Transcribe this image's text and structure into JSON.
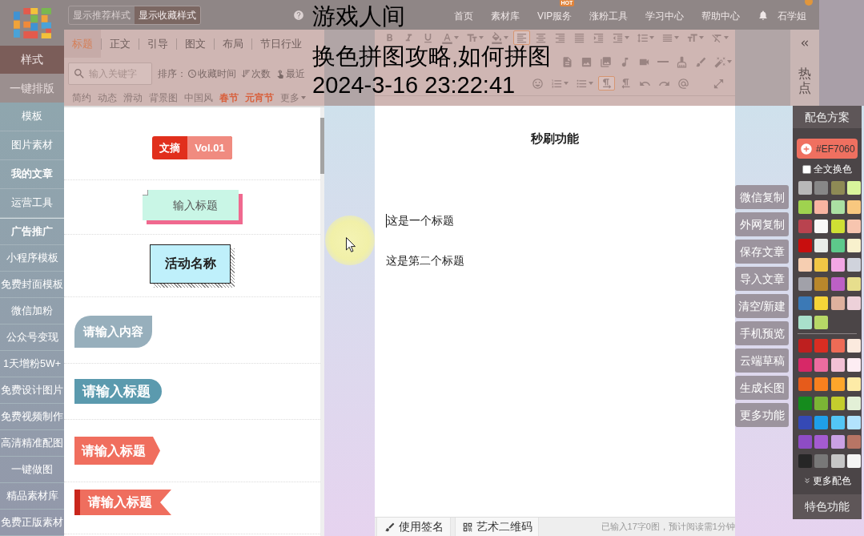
{
  "overlay_caption": {
    "lines": [
      "游戏人间",
      "换色拼图攻略,如何拼图",
      "2024-3-16 23:22:41"
    ]
  },
  "top_bar": {
    "style_toggle": [
      {
        "label": "显示推荐样式",
        "selected": false
      },
      {
        "label": "显示收藏样式",
        "selected": true
      }
    ],
    "nav": [
      {
        "label": "首页"
      },
      {
        "label": "素材库"
      },
      {
        "label": "VIP服务",
        "badge": "HOT"
      },
      {
        "label": "涨粉工具"
      },
      {
        "label": "学习中心"
      },
      {
        "label": "帮助中心"
      }
    ],
    "user": {
      "name": "石学姐",
      "badge_dot": true
    }
  },
  "mode_tabs": [
    {
      "label": "样式",
      "selected": true
    },
    {
      "label": "一键排版",
      "selected": false
    }
  ],
  "sidebar": {
    "groups": [
      [
        {
          "label": "模板",
          "bold": false
        },
        {
          "label": "图片素材",
          "bold": false
        },
        {
          "label": "我的文章",
          "bold": true
        },
        {
          "label": "运营工具",
          "bold": false
        }
      ],
      [
        {
          "label": "广告推广",
          "bold": true
        },
        {
          "label": "小程序模板",
          "bold": false
        },
        {
          "label": "免费封面模板",
          "bold": false
        },
        {
          "label": "微信加粉",
          "bold": false
        },
        {
          "label": "公众号变现",
          "bold": false
        },
        {
          "label": "1天增粉5W+",
          "bold": false
        },
        {
          "label": "免费设计图片",
          "bold": false
        },
        {
          "label": "免费视频制作",
          "bold": false
        },
        {
          "label": "高清精准配图",
          "bold": false
        },
        {
          "label": "一键做图",
          "bold": false
        },
        {
          "label": "精品素材库",
          "bold": false
        },
        {
          "label": "免费正版素材",
          "bold": false
        }
      ]
    ]
  },
  "style_panel": {
    "tabs": [
      {
        "label": "标题",
        "selected": true
      },
      {
        "label": "正文",
        "selected": false
      },
      {
        "label": "引导",
        "selected": false
      },
      {
        "label": "图文",
        "selected": false
      },
      {
        "label": "布局",
        "selected": false
      },
      {
        "label": "节日行业",
        "selected": false
      }
    ],
    "search": {
      "placeholder": "输入关键字"
    },
    "sort": {
      "label": "排序：",
      "options": [
        {
          "kind": "time",
          "label": "收藏时间"
        },
        {
          "kind": "count",
          "label": "次数"
        },
        {
          "kind": "recent",
          "label": "最近"
        }
      ]
    },
    "categories": [
      {
        "label": "简约",
        "featured": false
      },
      {
        "label": "动态",
        "featured": false
      },
      {
        "label": "滑动",
        "featured": false
      },
      {
        "label": "背景图",
        "featured": false
      },
      {
        "label": "中国风",
        "featured": false
      },
      {
        "label": "春节",
        "featured": true
      },
      {
        "label": "元宵节",
        "featured": true
      },
      {
        "label": "更多",
        "featured": false
      }
    ],
    "templates": [
      {
        "kind": "badge",
        "tag": "文摘",
        "issue": "Vol.01"
      },
      {
        "kind": "shadow",
        "text": "输入标题"
      },
      {
        "kind": "box3d",
        "text": "活动名称"
      },
      {
        "kind": "tab",
        "text": "请输入内容"
      },
      {
        "kind": "pill",
        "text": "请输入标题"
      },
      {
        "kind": "arrow",
        "text": "请输入标题"
      },
      {
        "kind": "ribbon",
        "text": "请输入标题"
      }
    ]
  },
  "toolbar": {
    "rows": [
      [
        {
          "kind": "bold",
          "selected": false,
          "dropdown": false
        },
        {
          "kind": "italic",
          "selected": false,
          "dropdown": false
        },
        {
          "kind": "underline",
          "selected": false,
          "dropdown": false
        },
        {
          "kind": "font-color",
          "selected": false,
          "dropdown": true
        },
        {
          "kind": "font-size",
          "selected": false,
          "dropdown": true
        },
        {
          "kind": "highlight",
          "selected": false,
          "dropdown": true
        },
        {
          "kind": "align-left",
          "selected": true,
          "dropdown": false
        },
        {
          "kind": "align-center",
          "selected": false,
          "dropdown": false
        },
        {
          "kind": "align-right",
          "selected": false,
          "dropdown": false
        },
        {
          "kind": "justify",
          "selected": false,
          "dropdown": false
        },
        {
          "kind": "indent",
          "selected": false,
          "dropdown": false
        },
        {
          "kind": "outdent",
          "selected": false,
          "dropdown": true
        },
        {
          "kind": "line-height",
          "selected": false,
          "dropdown": true
        },
        {
          "kind": "paragraph-spacing",
          "selected": false,
          "dropdown": true
        },
        {
          "kind": "letter-spacing",
          "selected": false,
          "dropdown": true
        },
        {
          "kind": "clear-format",
          "selected": false,
          "dropdown": true
        }
      ],
      [
        {
          "kind": "document",
          "selected": false,
          "dropdown": false
        },
        {
          "kind": "image",
          "selected": false,
          "dropdown": false
        },
        {
          "kind": "gallery",
          "selected": false,
          "dropdown": false
        },
        {
          "kind": "music",
          "selected": false,
          "dropdown": false
        },
        {
          "kind": "video",
          "selected": false,
          "dropdown": false
        },
        {
          "kind": "horizontal-rule",
          "selected": false,
          "dropdown": false
        },
        {
          "kind": "eraser",
          "selected": false,
          "dropdown": false
        },
        {
          "kind": "format-painter",
          "selected": false,
          "dropdown": false
        },
        {
          "kind": "magic-wand",
          "selected": false,
          "dropdown": true
        }
      ],
      [
        {
          "kind": "emoji",
          "selected": false,
          "dropdown": false
        },
        {
          "kind": "ordered-list",
          "selected": false,
          "dropdown": true
        },
        {
          "kind": "bullet-list",
          "selected": false,
          "dropdown": true
        },
        {
          "kind": "ltr",
          "selected": true,
          "dropdown": false
        },
        {
          "kind": "rtl",
          "selected": false,
          "dropdown": false
        },
        {
          "kind": "undo",
          "selected": false,
          "dropdown": false
        },
        {
          "kind": "redo",
          "selected": false,
          "dropdown": false
        },
        {
          "kind": "mention",
          "selected": false,
          "dropdown": false
        }
      ]
    ],
    "right": [
      {
        "kind": "fullscreen",
        "selected": false,
        "dropdown": false
      }
    ]
  },
  "side_strip": {
    "label": "热点"
  },
  "editor": {
    "title": "秒刷功能",
    "paragraphs": [
      {
        "text": "这是一个标题",
        "caret": true
      },
      {
        "text": "这是第二个标题",
        "caret": false
      }
    ],
    "footer": {
      "buttons": [
        {
          "kind": "signature",
          "label": "使用签名"
        },
        {
          "kind": "qrcode",
          "label": "艺术二维码"
        }
      ],
      "status": "已输入17字0图，预计阅读需1分钟"
    }
  },
  "actions": [
    "微信复制",
    "外网复制",
    "保存文章",
    "导入文章",
    "清空/新建",
    "手机预览",
    "云端草稿",
    "生成长图",
    "更多功能"
  ],
  "color_panel": {
    "title": "配色方案",
    "current": {
      "value": "#EF7060",
      "color": "#ef7060"
    },
    "apply_all": {
      "label": "全文换色",
      "checked": false
    },
    "swatch_groups": [
      [
        {
          "color": "#b8b8b8"
        },
        {
          "color": "#878787"
        },
        {
          "color": "#8e8a55"
        },
        {
          "color": "#d8f59b"
        },
        {
          "color": "#9fd24f"
        },
        {
          "color": "#f8b4a1"
        },
        {
          "color": "#abe0a2"
        },
        {
          "color": "#f8c87f"
        },
        {
          "color": "#b9434f"
        },
        {
          "color": "#f8f8f8"
        },
        {
          "color": "#cfe034"
        },
        {
          "color": "#f7c5af"
        },
        {
          "color": "#c80e0e"
        },
        {
          "color": "#e9ece9"
        },
        {
          "color": "#5dc98b"
        },
        {
          "color": "#f8f1cd"
        },
        {
          "color": "#f6ceb1"
        },
        {
          "color": "#f1c645"
        },
        {
          "color": "#f3a7e4"
        },
        {
          "color": "#d0d3dc"
        },
        {
          "color": "#a1a1a9"
        },
        {
          "color": "#b9872b"
        },
        {
          "color": "#bc60c5"
        },
        {
          "color": "#e7de8d"
        },
        {
          "color": "#3b79b6"
        },
        {
          "color": "#f5d438"
        },
        {
          "color": "#deb19e"
        },
        {
          "color": "#edd1d9"
        },
        {
          "color": "#a9e0cb"
        },
        {
          "color": "#b7d867"
        }
      ],
      [
        {
          "color": "#be1f1f"
        },
        {
          "color": "#da2d22"
        },
        {
          "color": "#ee6b56"
        },
        {
          "color": "#fbeade"
        },
        {
          "color": "#d72867"
        },
        {
          "color": "#ec6c9f"
        },
        {
          "color": "#f2c1d5"
        },
        {
          "color": "#fdedf3"
        },
        {
          "color": "#e65b1b"
        },
        {
          "color": "#f8801e"
        },
        {
          "color": "#fda62b"
        },
        {
          "color": "#fdeba7"
        },
        {
          "color": "#158b1d"
        },
        {
          "color": "#7bb535"
        },
        {
          "color": "#c4cd2d"
        },
        {
          "color": "#e3f0d7"
        },
        {
          "color": "#3549b5"
        },
        {
          "color": "#1f9fe9"
        },
        {
          "color": "#53c6f5"
        },
        {
          "color": "#b2e3fd"
        },
        {
          "color": "#8e4cc5"
        },
        {
          "color": "#a45bd1"
        },
        {
          "color": "#caa1e4"
        },
        {
          "color": "#b77565"
        },
        {
          "color": "#262626"
        },
        {
          "color": "#787878"
        },
        {
          "color": "#c6c6c6"
        },
        {
          "color": "#f5f5f5"
        }
      ]
    ],
    "more": "更多配色",
    "footer": "特色功能"
  }
}
